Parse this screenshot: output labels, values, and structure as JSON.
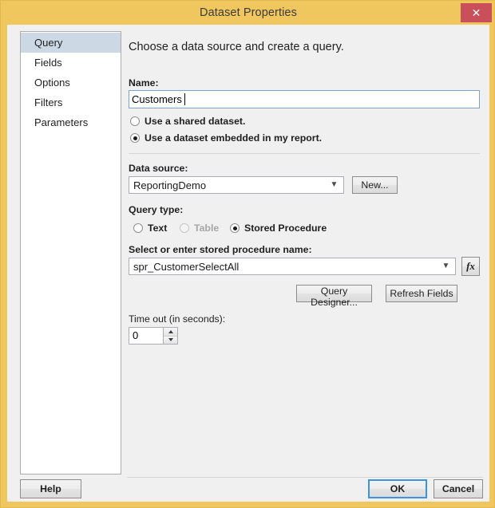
{
  "window": {
    "title": "Dataset Properties",
    "close_label": "✕",
    "frame_color": "#EFC75E",
    "close_color": "#C9505A",
    "body_color": "#F0F0F0",
    "selection_color": "#CCD9E4",
    "focus_color": "#3C94E0"
  },
  "sidebar": {
    "items": [
      {
        "label": "Query",
        "selected": true
      },
      {
        "label": "Fields",
        "selected": false
      },
      {
        "label": "Options",
        "selected": false
      },
      {
        "label": "Filters",
        "selected": false
      },
      {
        "label": "Parameters",
        "selected": false
      }
    ]
  },
  "pane": {
    "heading": "Choose a data source and create a query.",
    "name": {
      "label": "Name:",
      "value": "Customers"
    },
    "dataset_source": {
      "options": [
        {
          "label": "Use a shared dataset.",
          "checked": false
        },
        {
          "label": "Use a dataset embedded in my report.",
          "checked": true
        }
      ]
    },
    "data_source": {
      "label": "Data source:",
      "value": "ReportingDemo",
      "new_button": "New..."
    },
    "query_type": {
      "label": "Query type:",
      "options": [
        {
          "label": "Text",
          "checked": false,
          "disabled": false
        },
        {
          "label": "Table",
          "checked": false,
          "disabled": true
        },
        {
          "label": "Stored Procedure",
          "checked": true,
          "disabled": false
        }
      ]
    },
    "stored_procedure": {
      "label": "Select or enter stored procedure name:",
      "value": "spr_CustomerSelectAll",
      "expression_button": "fx"
    },
    "actions": {
      "query_designer": "Query Designer...",
      "refresh_fields": "Refresh Fields"
    },
    "timeout": {
      "label": "Time out (in seconds):",
      "value": "0"
    }
  },
  "footer": {
    "help": "Help",
    "ok": "OK",
    "cancel": "Cancel"
  }
}
